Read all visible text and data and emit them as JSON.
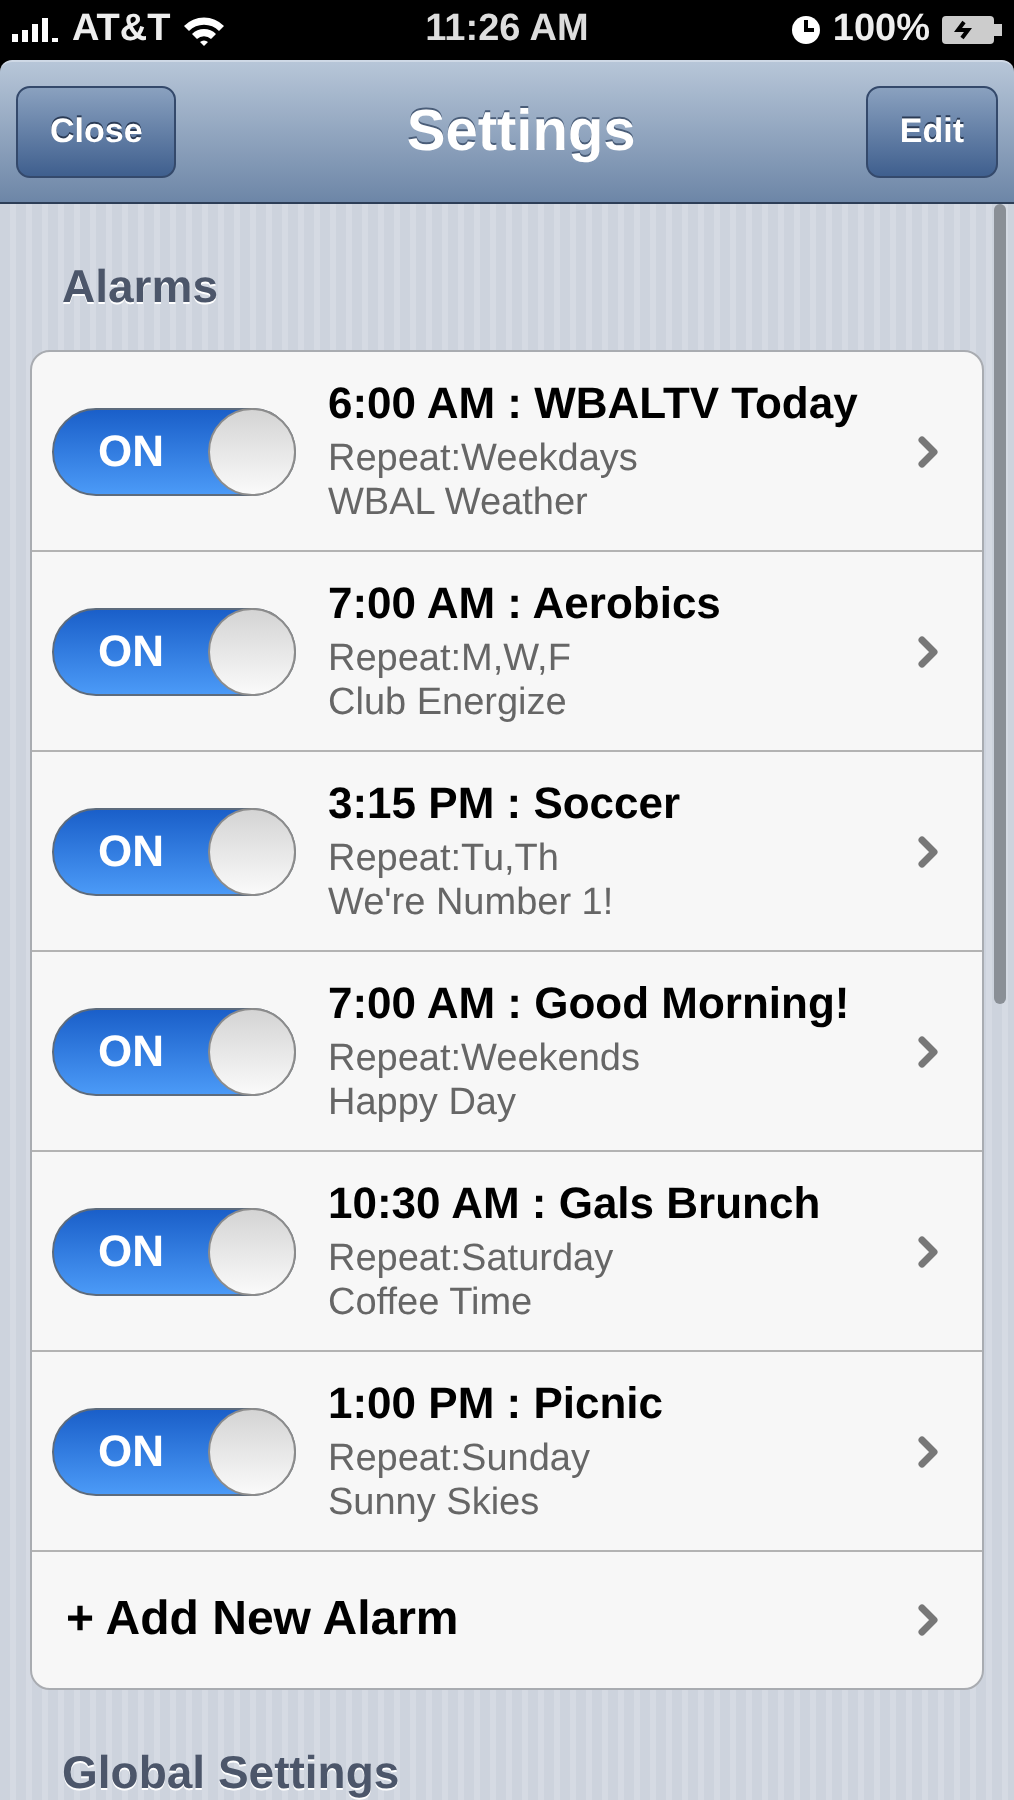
{
  "status_bar": {
    "carrier": "AT&T",
    "time": "11:26 AM",
    "battery": "100%"
  },
  "nav": {
    "title": "Settings",
    "left_button": "Close",
    "right_button": "Edit"
  },
  "sections": [
    {
      "header": "Alarms",
      "alarms": [
        {
          "on": true,
          "switch_label": "ON",
          "title": "6:00 AM : WBALTV Today",
          "repeat": "Repeat:Weekdays",
          "subtitle": "WBAL Weather"
        },
        {
          "on": true,
          "switch_label": "ON",
          "title": "7:00 AM : Aerobics",
          "repeat": "Repeat:M,W,F",
          "subtitle": "Club Energize"
        },
        {
          "on": true,
          "switch_label": "ON",
          "title": "3:15 PM : Soccer",
          "repeat": "Repeat:Tu,Th",
          "subtitle": "We're Number 1!"
        },
        {
          "on": true,
          "switch_label": "ON",
          "title": "7:00 AM : Good Morning!",
          "repeat": "Repeat:Weekends",
          "subtitle": "Happy Day"
        },
        {
          "on": true,
          "switch_label": "ON",
          "title": "10:30 AM : Gals Brunch",
          "repeat": "Repeat:Saturday",
          "subtitle": "Coffee Time"
        },
        {
          "on": true,
          "switch_label": "ON",
          "title": "1:00 PM : Picnic",
          "repeat": "Repeat:Sunday",
          "subtitle": "Sunny Skies"
        }
      ],
      "add_row": "+ Add New Alarm"
    },
    {
      "header": "Global Settings"
    }
  ]
}
